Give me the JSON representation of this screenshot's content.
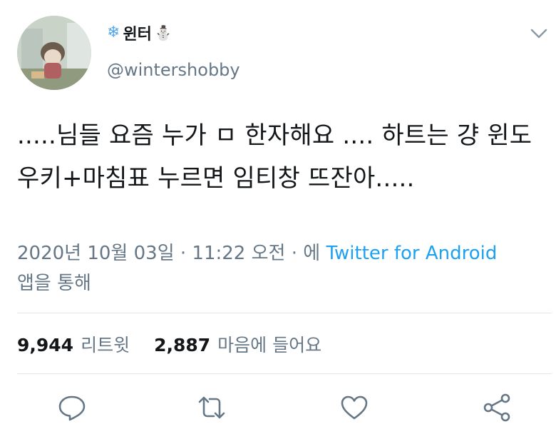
{
  "user": {
    "display_name": "윈터",
    "name_prefix_emoji": "❄",
    "name_suffix_emoji": "⛄",
    "handle": "@wintershobby",
    "avatar": "avatar-photo"
  },
  "tweet": {
    "text": ".....님들 요즘 누가 ㅁ 한자해요 .... 하트는 걍 윈도우키+마침표 누르면 임티창 뜨잔아.....",
    "timestamp": "2020년 10월 03일 · 11:22 오전 · 에 ",
    "source_link": "Twitter for Android",
    "via_suffix": "앱을 통해"
  },
  "stats": {
    "retweets_count": "9,944",
    "retweets_label": "리트윗",
    "likes_count": "2,887",
    "likes_label": "마음에 들어요"
  },
  "actions": {
    "reply": "reply-icon",
    "retweet": "retweet-icon",
    "like": "heart-icon",
    "share": "share-icon"
  },
  "colors": {
    "text": "#14171a",
    "secondary": "#657786",
    "link": "#1da1f2",
    "divider": "#e1e8ed"
  }
}
